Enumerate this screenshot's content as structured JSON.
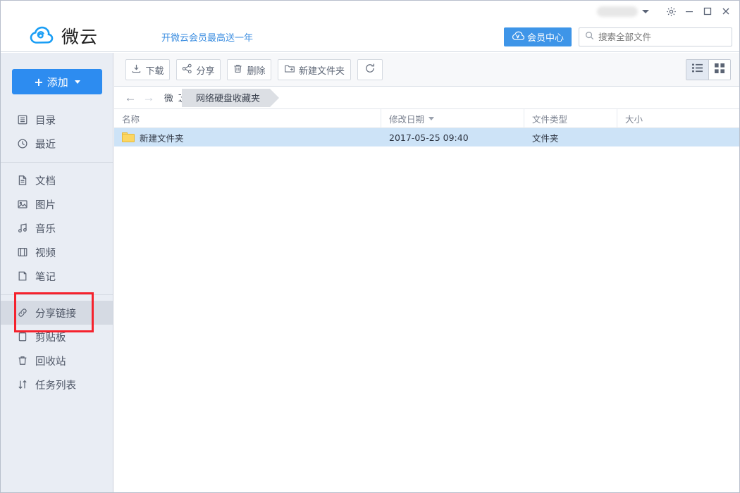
{
  "window": {
    "user_account": "",
    "buttons": [
      {
        "name": "settings",
        "icon": "gear-icon"
      },
      {
        "name": "minimize",
        "icon": "minimize-icon"
      },
      {
        "name": "maximize",
        "icon": "maximize-icon"
      },
      {
        "name": "close",
        "icon": "close-icon"
      }
    ]
  },
  "header": {
    "logo_text": "微云",
    "logo_icon": "weiyun-cloud-logo",
    "promo_text": "开微云会员最高送一年",
    "member_button": "会员中心",
    "member_icon": "vip-cloud-icon",
    "search": {
      "placeholder": "搜索全部文件",
      "value": "",
      "icon": "search-icon"
    }
  },
  "sidebar": {
    "add_button": "添加",
    "groups": [
      {
        "items": [
          {
            "label": "目录",
            "icon": "list-icon",
            "active": false
          },
          {
            "label": "最近",
            "icon": "clock-icon",
            "active": false
          }
        ]
      },
      {
        "items": [
          {
            "label": "文档",
            "icon": "document-icon",
            "active": false
          },
          {
            "label": "图片",
            "icon": "image-icon",
            "active": false
          },
          {
            "label": "音乐",
            "icon": "music-icon",
            "active": false
          },
          {
            "label": "视频",
            "icon": "video-icon",
            "active": false
          },
          {
            "label": "笔记",
            "icon": "note-icon",
            "active": false
          }
        ]
      },
      {
        "items": [
          {
            "label": "分享链接",
            "icon": "link-icon",
            "active": true
          },
          {
            "label": "剪贴板",
            "icon": "clipboard-icon",
            "active": false
          },
          {
            "label": "回收站",
            "icon": "trash-icon",
            "active": false
          },
          {
            "label": "任务列表",
            "icon": "transfer-icon",
            "active": false
          }
        ]
      }
    ]
  },
  "toolbar": {
    "buttons": [
      {
        "label": "下载",
        "icon": "download-icon"
      },
      {
        "label": "分享",
        "icon": "share-icon"
      },
      {
        "label": "删除",
        "icon": "trash-icon"
      },
      {
        "label": "新建文件夹",
        "icon": "new-folder-icon"
      },
      {
        "label": "",
        "icon": "refresh-icon"
      }
    ],
    "views": [
      {
        "name": "list-view",
        "icon": "list-view-icon",
        "selected": true
      },
      {
        "name": "grid-view",
        "icon": "grid-view-icon",
        "selected": false
      }
    ]
  },
  "breadcrumb": {
    "back_icon": "arrow-left-icon",
    "forward_icon": "arrow-right-icon",
    "root": "微云",
    "current": "网络硬盘收藏夹"
  },
  "filelist": {
    "columns": [
      {
        "label": "名称",
        "sorted": false
      },
      {
        "label": "修改日期",
        "sorted": true
      },
      {
        "label": "文件类型",
        "sorted": false
      },
      {
        "label": "大小",
        "sorted": false
      }
    ],
    "rows": [
      {
        "name": "新建文件夹",
        "modified": "2017-05-25 09:40",
        "type": "文件夹",
        "size": "",
        "icon": "folder-icon",
        "selected": true
      }
    ]
  },
  "annotation": {
    "highlight_color": "#f5222d",
    "arrow_color": "#f5333a",
    "target": "分享链接"
  }
}
